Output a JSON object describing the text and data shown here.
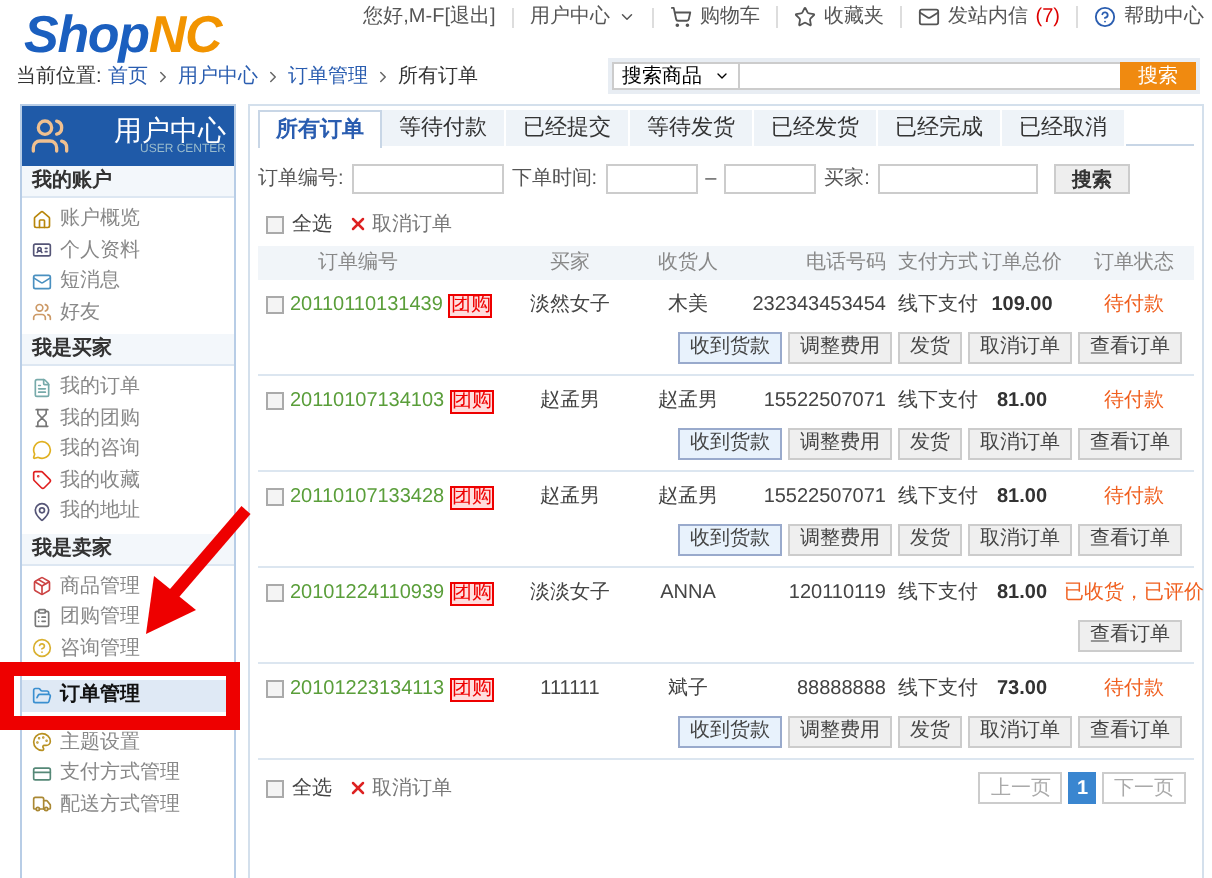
{
  "logo": {
    "first": "Shop",
    "second": "NC"
  },
  "top_links": [
    {
      "kind": "text",
      "label": "您好,M-F"
    },
    {
      "kind": "link",
      "label": "[退出]"
    },
    {
      "kind": "menu",
      "label": "用户中心"
    },
    {
      "kind": "cart",
      "label": "购物车"
    },
    {
      "kind": "fav",
      "label": "收藏夹"
    },
    {
      "kind": "mail",
      "label": "发站内信",
      "count": "(7)"
    },
    {
      "kind": "help",
      "label": "帮助中心"
    }
  ],
  "breadcrumb": {
    "prefix": "当前位置:",
    "items": [
      "首页",
      "用户中心",
      "订单管理"
    ],
    "current": "所有订单"
  },
  "search": {
    "scope": "搜索商品",
    "button": "搜索"
  },
  "sidebar": {
    "title": "用户中心",
    "subtitle": "USER CENTER",
    "sections": [
      {
        "title": "我的账户",
        "items": [
          {
            "label": "账户概览",
            "selected": false
          },
          {
            "label": "个人资料",
            "selected": false
          },
          {
            "label": "短消息",
            "selected": false
          },
          {
            "label": "好友",
            "selected": false
          }
        ]
      },
      {
        "title": "我是买家",
        "items": [
          {
            "label": "我的订单",
            "selected": false
          },
          {
            "label": "我的团购",
            "selected": false
          },
          {
            "label": "我的咨询",
            "selected": false
          },
          {
            "label": "我的收藏",
            "selected": false
          },
          {
            "label": "我的地址",
            "selected": false
          }
        ]
      },
      {
        "title": "我是卖家",
        "items": [
          {
            "label": "商品管理",
            "selected": false
          },
          {
            "label": "团购管理",
            "selected": false
          },
          {
            "label": "咨询管理",
            "selected": false
          },
          {
            "label": "订单管理",
            "selected": true
          },
          {
            "label": "主题设置",
            "selected": false
          },
          {
            "label": "支付方式管理",
            "selected": false
          },
          {
            "label": "配送方式管理",
            "selected": false
          }
        ]
      }
    ]
  },
  "tabs": [
    {
      "label": "所有订单",
      "selected": true
    },
    {
      "label": "等待付款",
      "selected": false
    },
    {
      "label": "已经提交",
      "selected": false
    },
    {
      "label": "等待发货",
      "selected": false
    },
    {
      "label": "已经发货",
      "selected": false
    },
    {
      "label": "已经完成",
      "selected": false
    },
    {
      "label": "已经取消",
      "selected": false
    }
  ],
  "filters": {
    "order_no": "订单编号:",
    "time": "下单时间:",
    "dash": "–",
    "buyer": "买家:",
    "button": "搜索"
  },
  "bulk_top": {
    "select_all": "全选",
    "checked": false,
    "cancel": "取消订单"
  },
  "bulk_bottom": {
    "select_all": "全选",
    "checked": false,
    "cancel": "取消订单"
  },
  "columns": [
    "订单编号",
    "买家",
    "收货人",
    "电话号码",
    "支付方式",
    "订单总价",
    "订单状态"
  ],
  "orders": [
    {
      "checked": false,
      "order_no": "20110110131439",
      "tag": "团购",
      "buyer": "淡然女子",
      "receiver": "木美",
      "phone": "232343453454",
      "payment": "线下支付",
      "total": "109.00",
      "status": "待付款",
      "actions": [
        "收到货款",
        "调整费用",
        "发货",
        "取消订单",
        "查看订单"
      ]
    },
    {
      "checked": false,
      "order_no": "20110107134103",
      "tag": "团购",
      "buyer": "赵孟男",
      "receiver": "赵孟男",
      "phone": "15522507071",
      "payment": "线下支付",
      "total": "81.00",
      "status": "待付款",
      "actions": [
        "收到货款",
        "调整费用",
        "发货",
        "取消订单",
        "查看订单"
      ]
    },
    {
      "checked": false,
      "order_no": "20110107133428",
      "tag": "团购",
      "buyer": "赵孟男",
      "receiver": "赵孟男",
      "phone": "15522507071",
      "payment": "线下支付",
      "total": "81.00",
      "status": "待付款",
      "actions": [
        "收到货款",
        "调整费用",
        "发货",
        "取消订单",
        "查看订单"
      ]
    },
    {
      "checked": false,
      "order_no": "20101224110939",
      "tag": "团购",
      "buyer": "淡淡女子",
      "receiver": "ANNA",
      "phone": "120110119",
      "payment": "线下支付",
      "total": "81.00",
      "status": "已收货，已评价",
      "actions": [
        "查看订单"
      ]
    },
    {
      "checked": false,
      "order_no": "20101223134113",
      "tag": "团购",
      "buyer": "111111",
      "receiver": "斌子",
      "phone": "88888888",
      "payment": "线下支付",
      "total": "73.00",
      "status": "待付款",
      "actions": [
        "收到货款",
        "调整费用",
        "发货",
        "取消订单",
        "查看订单"
      ]
    }
  ],
  "pagination": {
    "prev": "上一页",
    "pages": [
      {
        "label": "1",
        "selected": true
      }
    ],
    "next": "下一页"
  }
}
